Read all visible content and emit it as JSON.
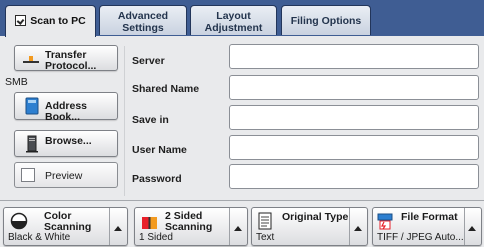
{
  "tabs": [
    {
      "label": "Scan to PC",
      "active": true
    },
    {
      "label": "Advanced Settings",
      "line1": "Advanced",
      "line2": "Settings"
    },
    {
      "label": "Layout Adjustment",
      "line1": "Layout",
      "line2": "Adjustment"
    },
    {
      "label": "Filing Options"
    }
  ],
  "left": {
    "transfer_protocol": {
      "line1": "Transfer",
      "line2": "Protocol...",
      "value": "SMB"
    },
    "address_book": "Address Book...",
    "browse": "Browse...",
    "preview": "Preview"
  },
  "fields": [
    {
      "label": "Server",
      "value": ""
    },
    {
      "label": "Shared Name",
      "value": ""
    },
    {
      "label": "Save in",
      "value": ""
    },
    {
      "label": "User Name",
      "value": ""
    },
    {
      "label": "Password",
      "value": ""
    }
  ],
  "bottom": [
    {
      "line1": "Color",
      "line2": "Scanning",
      "value": "Black & White",
      "icon": "color-scanning-icon"
    },
    {
      "line1": "2 Sided",
      "line2": "Scanning",
      "value": "1 Sided",
      "icon": "two-sided-scanning-icon"
    },
    {
      "line1": "Original Type",
      "line2": "",
      "value": "Text",
      "icon": "original-type-icon"
    },
    {
      "line1": "File Format",
      "line2": "",
      "value": "TIFF / JPEG Auto...",
      "icon": "file-format-icon"
    }
  ],
  "colors": {
    "tabbar": "#3f5d93",
    "accent_orange": "#f29a1f"
  }
}
